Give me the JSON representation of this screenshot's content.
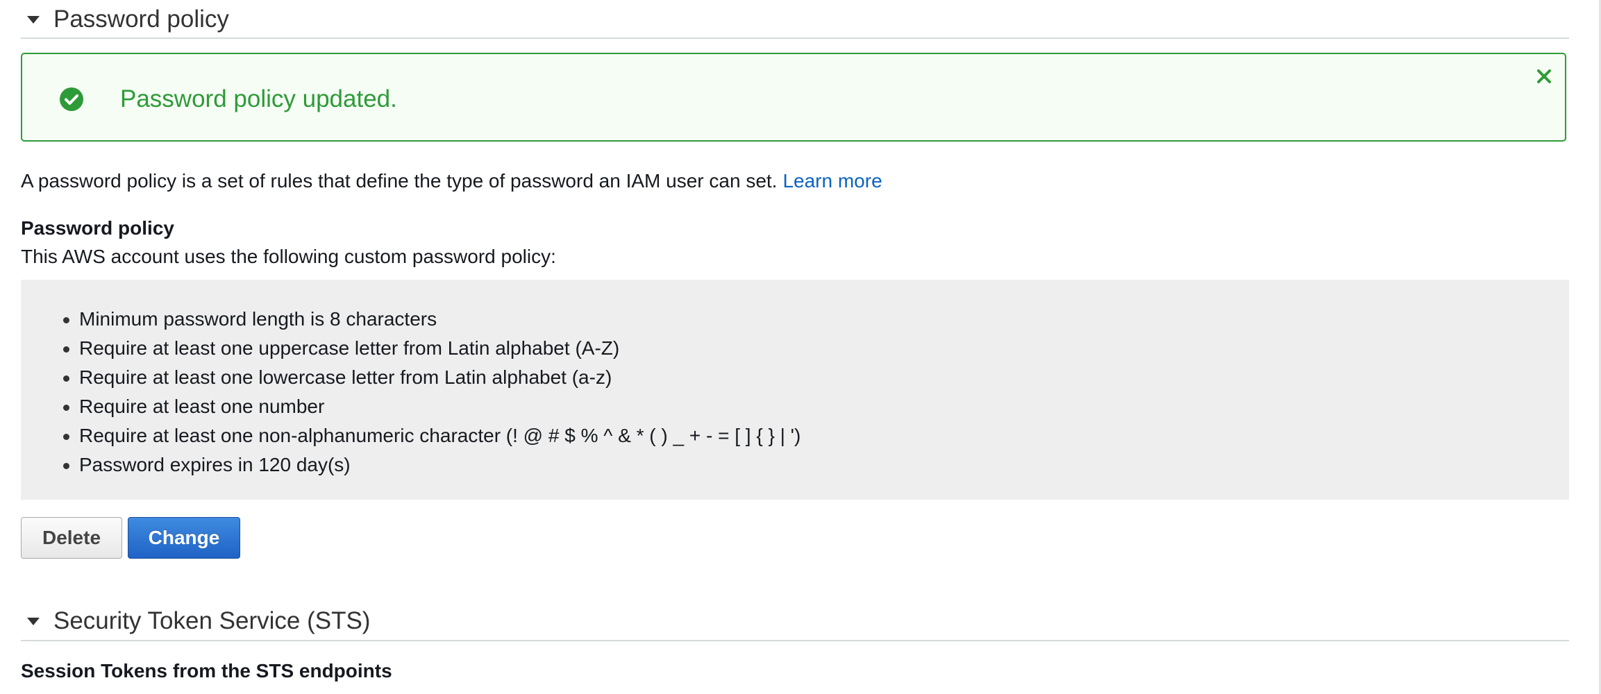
{
  "sections": {
    "password_policy": {
      "title": "Password policy"
    },
    "sts": {
      "title": "Security Token Service (STS)",
      "subheading": "Session Tokens from the STS endpoints"
    }
  },
  "alert": {
    "message": "Password policy updated.",
    "type": "success",
    "icon": "check-circle-icon",
    "close_icon": "close-icon"
  },
  "intro": {
    "text": "A password policy is a set of rules that define the type of password an IAM user can set.",
    "link_label": "Learn more"
  },
  "policy": {
    "heading": "Password policy",
    "description": "This AWS account uses the following custom password policy:",
    "rules": [
      "Minimum password length is 8 characters",
      "Require at least one uppercase letter from Latin alphabet (A-Z)",
      "Require at least one lowercase letter from Latin alphabet (a-z)",
      "Require at least one number",
      "Require at least one non-alphanumeric character (! @ # $ % ^ & * ( ) _ + - = [ ] { } | ')",
      "Password expires in 120 day(s)"
    ]
  },
  "buttons": {
    "delete_label": "Delete",
    "change_label": "Change"
  },
  "colors": {
    "success": "#2d9b37",
    "link": "#0a63c0",
    "primary_button": "#1f63c6"
  }
}
